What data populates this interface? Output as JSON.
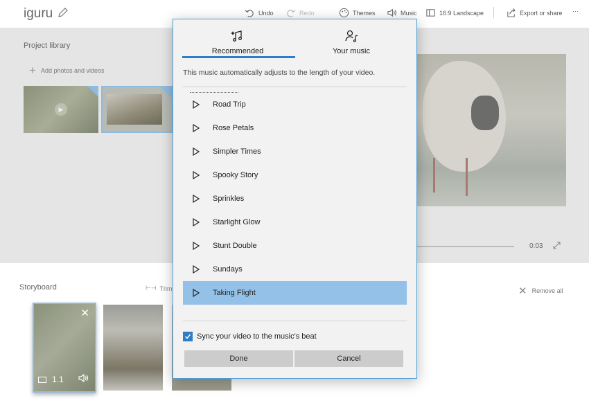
{
  "app": {
    "title": "iguru"
  },
  "toolbar": {
    "undo": "Undo",
    "redo": "Redo",
    "themes": "Themes",
    "music": "Music",
    "aspect": "16:9 Landscape",
    "export": "Export or share",
    "more": "···"
  },
  "library": {
    "title": "Project library",
    "add_label": "Add photos and videos"
  },
  "preview": {
    "time": "0:03"
  },
  "storyboard": {
    "title": "Storyboard",
    "trim": "Trim",
    "remove_all": "Remove all",
    "card1_duration": "1.1"
  },
  "dialog": {
    "tabs": [
      {
        "label": "Recommended",
        "icon": "music-notes-sparkle-icon",
        "selected": true
      },
      {
        "label": "Your music",
        "icon": "person-music-icon",
        "selected": false
      }
    ],
    "description": "This music automatically adjusts to the length of your video.",
    "songs": [
      {
        "name": "Road Trip"
      },
      {
        "name": "Rose Petals"
      },
      {
        "name": "Simpler Times"
      },
      {
        "name": "Spooky Story"
      },
      {
        "name": "Sprinkles"
      },
      {
        "name": "Starlight Glow"
      },
      {
        "name": "Stunt Double"
      },
      {
        "name": "Sundays"
      },
      {
        "name": "Taking Flight",
        "selected": true
      }
    ],
    "sync_label": "Sync your video to the music's beat",
    "sync_checked": true,
    "done": "Done",
    "cancel": "Cancel"
  },
  "colors": {
    "accent": "#2e7dc6",
    "selected_row": "#93c1e8",
    "dialog_border": "#4a9fd9"
  }
}
